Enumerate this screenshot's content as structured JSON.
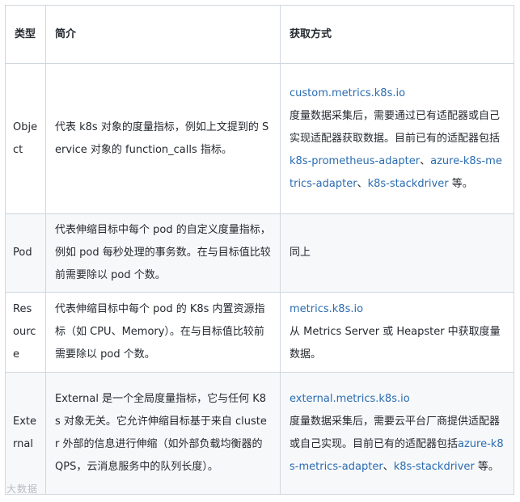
{
  "table": {
    "headers": {
      "type": "类型",
      "description": "简介",
      "method": "获取方式"
    },
    "rows": [
      {
        "type": "Object",
        "description": "代表 k8s 对象的度量指标，例如上文提到的 Service 对象的 function_calls 指标。",
        "method_link": "custom.metrics.k8s.io",
        "method_text_1": "度量数据采集后，需要通过已有适配器或自己实现适配器获取数据。目前已有的适配器包括 ",
        "adapter_1": "k8s-prometheus-adapter",
        "sep_1": "、",
        "adapter_2": "azure-k8s-metrics-adapter",
        "sep_2": "、",
        "adapter_3": "k8s-stackdriver",
        "method_text_2": " 等。"
      },
      {
        "type": "Pod",
        "description": "代表伸缩目标中每个 pod 的自定义度量指标，例如 pod 每秒处理的事务数。在与目标值比较前需要除以 pod 个数。",
        "method_text": "同上"
      },
      {
        "type": "Resource",
        "description": "代表伸缩目标中每个 pod 的 K8s 内置资源指标（如 CPU、Memory）。在与目标值比较前需要除以 pod 个数。",
        "method_link": "metrics.k8s.io",
        "method_text": "从 Metrics Server 或 Heapster 中获取度量数据。"
      },
      {
        "type": "External",
        "description": "External 是一个全局度量指标，它与任何 K8s 对象无关。它允许伸缩目标基于来自 cluster 外部的信息进行伸缩（如外部负载均衡器的 QPS，云消息服务中的队列长度）。",
        "method_link": "external.metrics.k8s.io",
        "method_text_1": "度量数据采集后，需要云平台厂商提供适配器或自己实现。目前已有的适配器包括",
        "adapter_1": "azure-k8s-metrics-adapter",
        "sep_1": "、",
        "adapter_2": "k8s-stackdriver",
        "method_text_2": " 等。"
      }
    ]
  },
  "watermark": "大数据",
  "colors": {
    "link": "#2b6cb0",
    "border": "#d0d7de",
    "stripe": "#f6f8fa",
    "text": "#24292f"
  }
}
